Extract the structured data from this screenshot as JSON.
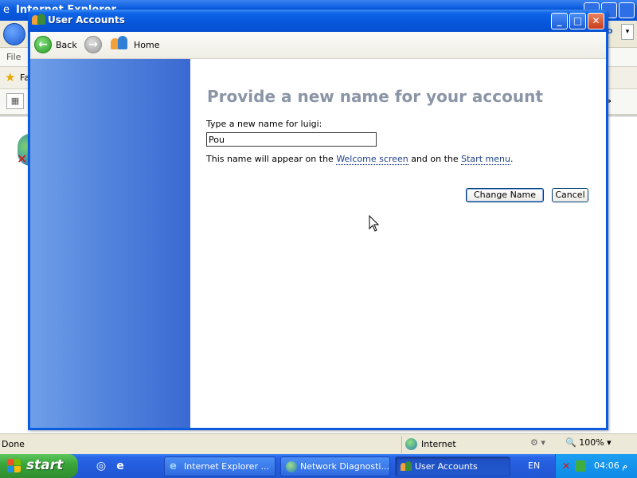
{
  "ie": {
    "title": "Internet Explorer",
    "menu_file": "File",
    "favorites_label": "Fa",
    "status_done": "Done",
    "status_zone": "Internet",
    "status_zoom": "100%"
  },
  "window": {
    "title": "User Accounts",
    "toolbar": {
      "back_label": "Back",
      "home_label": "Home"
    }
  },
  "form": {
    "heading": "Provide a new name for your account",
    "prompt": "Type a new name for luigi:",
    "input_value": "Pou",
    "help_prefix": "This name will appear on the ",
    "help_link1": "Welcome screen",
    "help_middle": " and on the ",
    "help_link2": "Start menu",
    "help_suffix": ".",
    "change_button": "Change Name",
    "cancel_button": "Cancel"
  },
  "taskbar": {
    "start_label": "start",
    "tasks": [
      {
        "label": "Internet Explorer ...",
        "active": false
      },
      {
        "label": "Network Diagnosti...",
        "active": false
      },
      {
        "label": "User Accounts",
        "active": true
      }
    ],
    "language": "EN",
    "clock": "04:06 م"
  },
  "colors": {
    "xp_blue": "#0a5ce0",
    "sidebar": "#5485dd",
    "heading": "#8b95a6",
    "start_green": "#3aa63a"
  },
  "icons": [
    "user-accounts-icon",
    "back-arrow-icon",
    "forward-arrow-icon",
    "home-users-icon",
    "minimize-icon",
    "maximize-icon",
    "close-icon",
    "windows-flag-icon",
    "ie-icon",
    "globe-icon",
    "cursor-icon"
  ]
}
